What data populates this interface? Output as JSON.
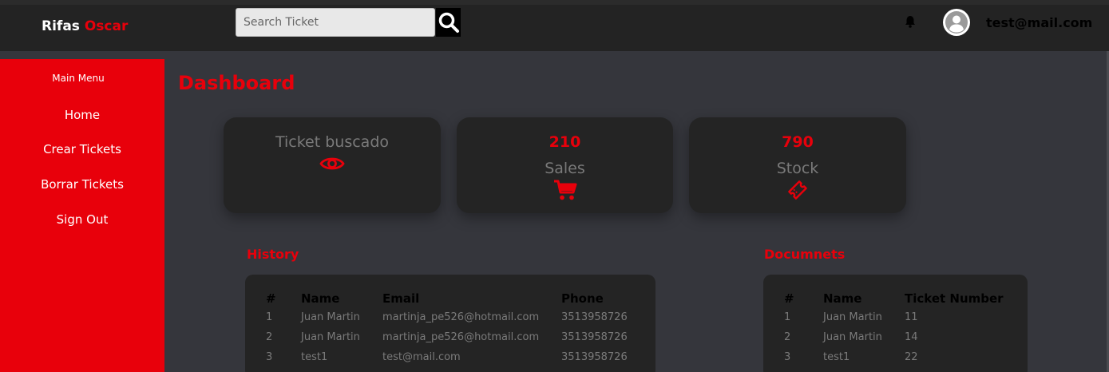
{
  "header": {
    "brand_first": "Rifas",
    "brand_second": "Oscar",
    "search_placeholder": "Search Ticket",
    "user_email": "test@mail.com"
  },
  "icons": {
    "search": "search-icon",
    "bell": "bell-icon",
    "avatar": "user-avatar-icon",
    "eye": "eye-icon",
    "cart": "shopping-cart-icon",
    "ticket": "ticket-icon"
  },
  "colors": {
    "accent": "#e8000b",
    "topbar": "#232323",
    "background": "#35363c",
    "card": "#242424",
    "muted_text": "#7a7a7a"
  },
  "sidebar": {
    "title": "Main Menu",
    "items": [
      {
        "label": "Home"
      },
      {
        "label": "Crear Tickets"
      },
      {
        "label": "Borrar Tickets"
      },
      {
        "label": "Sign Out"
      }
    ]
  },
  "main": {
    "title": "Dashboard",
    "cards": [
      {
        "label": "Ticket buscado"
      },
      {
        "value": "210",
        "label": "Sales"
      },
      {
        "value": "790",
        "label": "Stock"
      }
    ]
  },
  "history": {
    "title": "History",
    "columns": [
      "#",
      "Name",
      "Email",
      "Phone"
    ],
    "rows": [
      [
        "1",
        "Juan Martin",
        "martinja_pe526@hotmail.com",
        "3513958726"
      ],
      [
        "2",
        "Juan Martin",
        "martinja_pe526@hotmail.com",
        "3513958726"
      ],
      [
        "3",
        "test1",
        "test@mail.com",
        "3513958726"
      ]
    ]
  },
  "documents": {
    "title": "Documnets",
    "columns": [
      "#",
      "Name",
      "Ticket Number"
    ],
    "rows": [
      [
        "1",
        "Juan Martin",
        "11"
      ],
      [
        "2",
        "Juan Martin",
        "14"
      ],
      [
        "3",
        "test1",
        "22"
      ]
    ]
  }
}
